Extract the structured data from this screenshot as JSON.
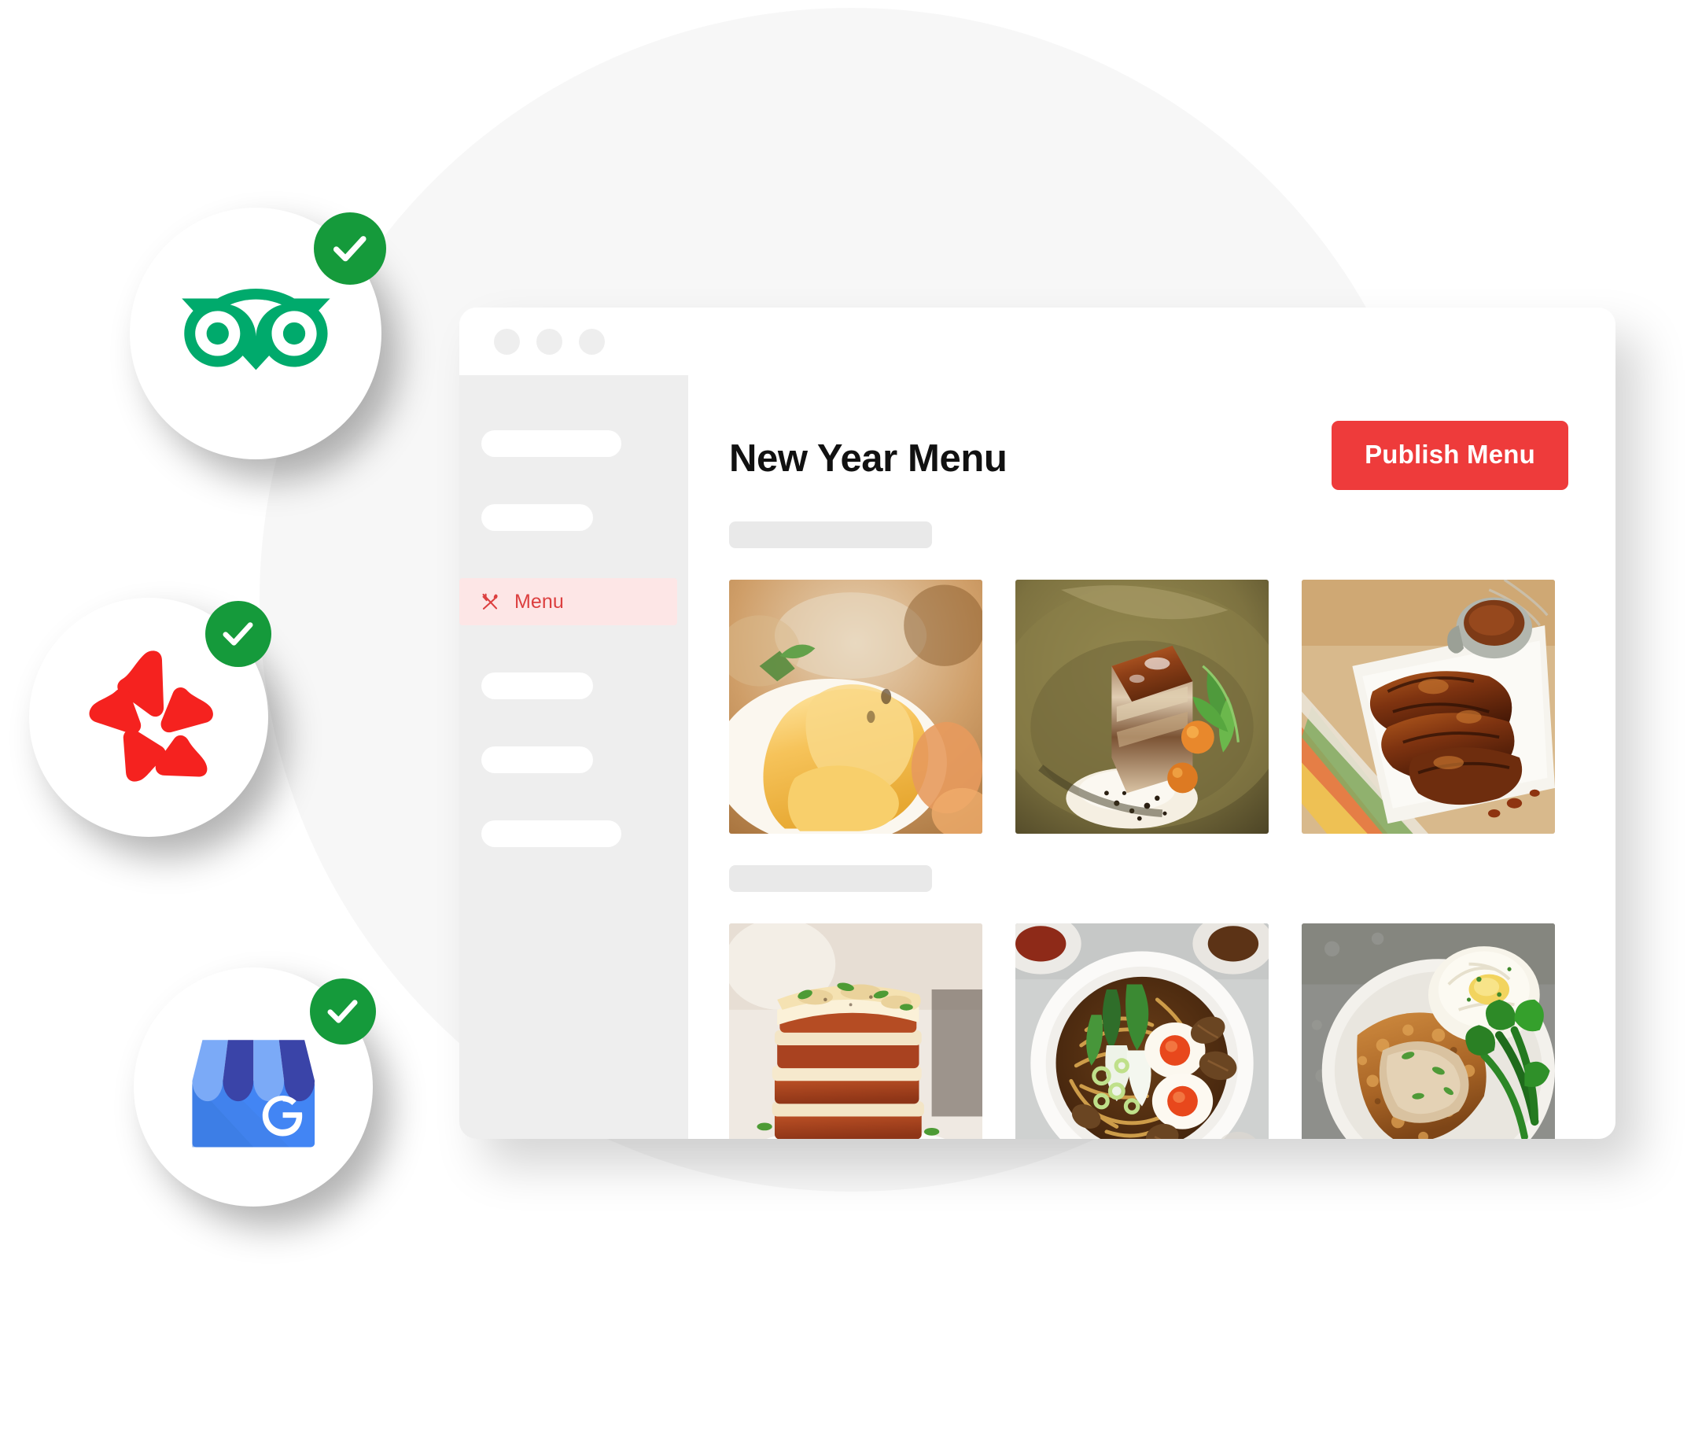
{
  "backdrop": {
    "circle_color": "#f7f7f7"
  },
  "browser": {
    "titlebar": {
      "dots": [
        "window-dot-1",
        "window-dot-2",
        "window-dot-3"
      ],
      "dot_color": "#eeeeee"
    },
    "sidebar": {
      "background": "#eeeeee",
      "items": [
        {
          "type": "skeleton",
          "name": "nav-placeholder-1",
          "width": 178
        },
        {
          "type": "skeleton",
          "name": "nav-placeholder-2",
          "width": 142
        },
        {
          "type": "link",
          "name": "nav-menu",
          "label": "Menu",
          "icon": "cutlery-icon",
          "active": true,
          "text_color": "#dc3f3f",
          "bg_color": "#fde6e6"
        },
        {
          "type": "skeleton",
          "name": "nav-placeholder-3",
          "width": 142
        },
        {
          "type": "skeleton",
          "name": "nav-placeholder-4",
          "width": 142
        },
        {
          "type": "skeleton",
          "name": "nav-placeholder-5",
          "width": 178
        }
      ]
    },
    "main": {
      "page_title": "New Year Menu",
      "publish_button": {
        "label": "Publish Menu",
        "color": "#ee3b3b",
        "text_color": "#ffffff"
      },
      "sections": [
        {
          "name": "menu-section-1",
          "heading_placeholder": "",
          "items": [
            {
              "name": "menu-photo-eggs-benedict",
              "alt": "eggs benedict with hollandaise sauce"
            },
            {
              "name": "menu-photo-pork-belly",
              "alt": "braised pork belly on ceramic plate"
            },
            {
              "name": "menu-photo-bbq-ribs",
              "alt": "barbecue ribs with dipping sauce"
            }
          ]
        },
        {
          "name": "menu-section-2",
          "heading_placeholder": "",
          "items": [
            {
              "name": "menu-photo-lasagna",
              "alt": "layered beef lasagna with herbs"
            },
            {
              "name": "menu-photo-ramen",
              "alt": "ramen noodle soup with soft eggs and bok choy"
            },
            {
              "name": "menu-photo-fried-chicken-steak",
              "alt": "chicken fried steak with mash and broccolini"
            }
          ]
        }
      ]
    }
  },
  "badges": [
    {
      "name": "tripadvisor-badge",
      "platform": "TripAdvisor",
      "icon": "tripadvisor-owl-icon",
      "brand_color": "#00aa6c",
      "verified": true,
      "check_color": "#159a3b"
    },
    {
      "name": "yelp-badge",
      "platform": "Yelp",
      "icon": "yelp-burst-icon",
      "brand_color": "#f5221f",
      "verified": true,
      "check_color": "#159a3b"
    },
    {
      "name": "google-business-badge",
      "platform": "Google My Business",
      "icon": "google-business-storefront-icon",
      "brand_color": "#4285f4",
      "verified": true,
      "check_color": "#159a3b"
    }
  ]
}
